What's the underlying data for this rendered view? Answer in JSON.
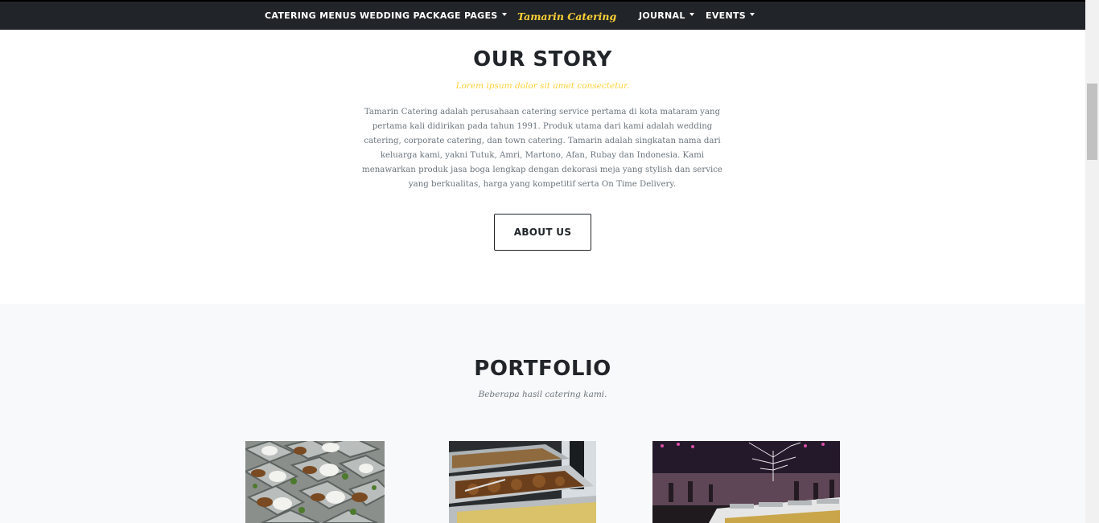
{
  "navbar": {
    "items": [
      {
        "label": "CATERING MENUS"
      },
      {
        "label": "WEDDING PACKAGE"
      },
      {
        "label": "PAGES"
      },
      {
        "label": "JOURNAL"
      },
      {
        "label": "EVENTS"
      }
    ],
    "brand": "Tamarin Catering"
  },
  "story": {
    "title": "OUR STORY",
    "subtitle": "Lorem ipsum dolor sit amet consectetur.",
    "body": "Tamarin Catering adalah perusahaan catering service pertama di kota mataram yang pertama kali didirikan pada tahun 1991. Produk utama dari kami adalah wedding catering, corporate catering, dan town catering. Tamarin adalah singkatan nama dari keluarga kami, yakni Tutuk, Amri, Martono, Afan, Rubay dan Indonesia. Kami menawarkan produk jasa boga lengkap dengan dekorasi meja yang stylish dan service yang berkualitas, harga yang kompetitif serta On Time Delivery.",
    "button": "ABOUT US"
  },
  "portfolio": {
    "title": "PORTFOLIO",
    "subtitle": "Beberapa hasil catering kami."
  },
  "colors": {
    "navbar_bg": "#212529",
    "accent": "#fed136",
    "section_alt_bg": "#f8f9fa",
    "text_dark": "#212529",
    "text_muted": "#6c757d"
  }
}
